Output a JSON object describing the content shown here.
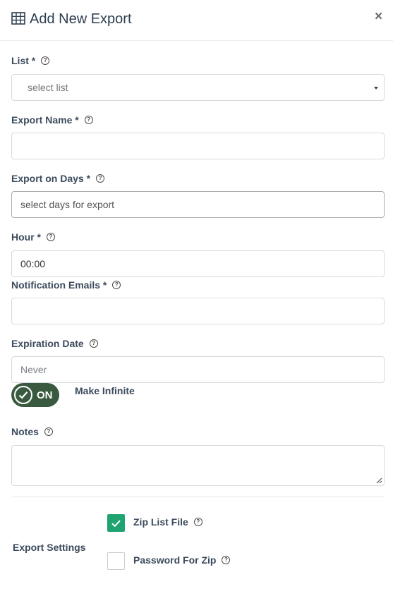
{
  "header": {
    "title": "Add New Export",
    "close_label": "×",
    "icon": "table-icon"
  },
  "fields": {
    "list": {
      "label": "List *",
      "placeholder": "select list"
    },
    "export_name": {
      "label": "Export Name *",
      "value": ""
    },
    "export_days": {
      "label": "Export on Days *",
      "placeholder": "select days for export"
    },
    "hour": {
      "label": "Hour *",
      "value": "00:00"
    },
    "notification_emails": {
      "label": "Notification Emails *",
      "value": ""
    },
    "expiration_date": {
      "label": "Expiration Date",
      "placeholder": "Never"
    },
    "make_infinite": {
      "label": "Make Infinite",
      "toggle_text": "ON",
      "state": true
    },
    "notes": {
      "label": "Notes",
      "value": ""
    }
  },
  "export_settings": {
    "label": "Export Settings",
    "zip_list_file": {
      "label": "Zip List File",
      "checked": true
    },
    "password_for_zip": {
      "label": "Password For Zip",
      "checked": false
    }
  },
  "help_glyph": "?",
  "colors": {
    "toggle": "#3a5a40",
    "checkbox": "#1fa36f",
    "label": "#3b4a5c"
  }
}
